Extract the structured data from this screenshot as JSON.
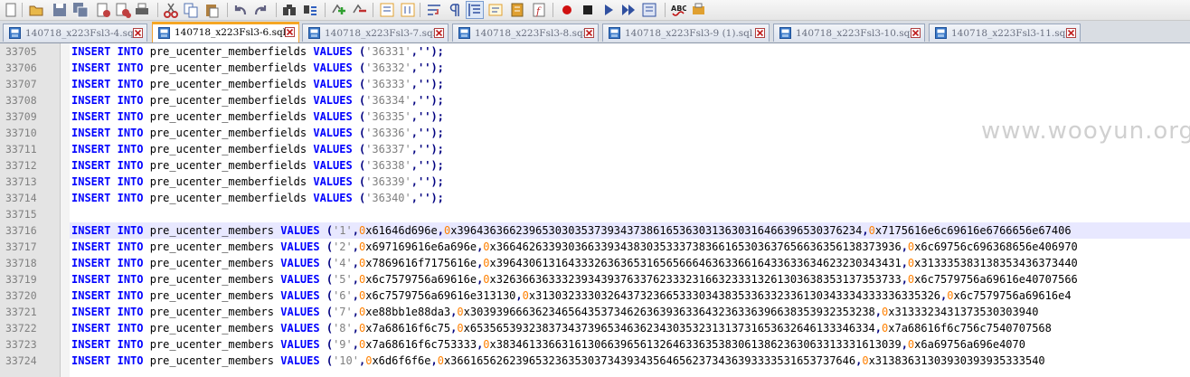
{
  "toolbar": {
    "buttons": [
      {
        "name": "new-file-icon",
        "color": "#ffffff"
      },
      {
        "name": "open-file-icon",
        "color": "#e8b84a"
      },
      {
        "name": "save-icon",
        "color": "#7080a0"
      },
      {
        "name": "save-all-icon",
        "color": "#7080a0"
      },
      {
        "name": "close-icon",
        "color": "#c04040"
      },
      {
        "name": "close-all-icon",
        "color": "#c04040"
      },
      {
        "name": "print-icon",
        "color": "#606060"
      },
      {
        "name": "cut-icon",
        "color": "#c03030"
      },
      {
        "name": "copy-icon",
        "color": "#5070b0"
      },
      {
        "name": "paste-icon",
        "color": "#b08040"
      },
      {
        "name": "undo-icon",
        "color": "#606080"
      },
      {
        "name": "redo-icon",
        "color": "#606080"
      },
      {
        "name": "find-icon",
        "color": "#404040"
      },
      {
        "name": "replace-icon",
        "color": "#3060c0"
      },
      {
        "name": "zoom-in-icon",
        "color": "#30a030"
      },
      {
        "name": "zoom-out-icon",
        "color": "#c03030"
      },
      {
        "name": "sync-vertical-icon",
        "color": "#e0a030"
      },
      {
        "name": "sync-horizontal-icon",
        "color": "#e0a030"
      },
      {
        "name": "word-wrap-icon",
        "color": "#3050a0"
      },
      {
        "name": "show-all-characters-icon",
        "color": "#3050a0"
      },
      {
        "name": "indent-guide-icon",
        "color": "#3050a0"
      },
      {
        "name": "user-language-icon",
        "color": "#e0a030"
      },
      {
        "name": "document-map-icon",
        "color": "#e0a030"
      },
      {
        "name": "function-list-icon",
        "color": "#c03030"
      },
      {
        "name": "record-macro-icon",
        "color": "#d01010"
      },
      {
        "name": "stop-recording-icon",
        "color": "#202020"
      },
      {
        "name": "play-macro-icon",
        "color": "#3050a0"
      },
      {
        "name": "run-macro-multiple-icon",
        "color": "#3050a0"
      },
      {
        "name": "save-macro-icon",
        "color": "#3050a0"
      },
      {
        "name": "spell-check-icon",
        "color": "#c01010"
      },
      {
        "name": "spell-settings-icon",
        "color": "#e0a030"
      }
    ]
  },
  "tabs": [
    {
      "label": "140718_x223Fsl3-4.sql",
      "active": false
    },
    {
      "label": "140718_x223Fsl3-6.sql",
      "active": true
    },
    {
      "label": "140718_x223Fsl3-7.sql",
      "active": false
    },
    {
      "label": "140718_x223Fsl3-8.sql",
      "active": false
    },
    {
      "label": "140718_x223Fsl3-9 (1).sql",
      "active": false
    },
    {
      "label": "140718_x223Fsl3-10.sql",
      "active": false
    },
    {
      "label": "140718_x223Fsl3-11.sql",
      "active": false
    }
  ],
  "editor": {
    "keywords": {
      "insert": "INSERT",
      "into": "INTO",
      "values": "VALUES"
    },
    "lines": [
      {
        "num": "33705",
        "table": "pre_ucenter_memberfields",
        "v1": "'36331'",
        "rest": ",'');"
      },
      {
        "num": "33706",
        "table": "pre_ucenter_memberfields",
        "v1": "'36332'",
        "rest": ",'');"
      },
      {
        "num": "33707",
        "table": "pre_ucenter_memberfields",
        "v1": "'36333'",
        "rest": ",'');"
      },
      {
        "num": "33708",
        "table": "pre_ucenter_memberfields",
        "v1": "'36334'",
        "rest": ",'');"
      },
      {
        "num": "33709",
        "table": "pre_ucenter_memberfields",
        "v1": "'36335'",
        "rest": ",'');"
      },
      {
        "num": "33710",
        "table": "pre_ucenter_memberfields",
        "v1": "'36336'",
        "rest": ",'');"
      },
      {
        "num": "33711",
        "table": "pre_ucenter_memberfields",
        "v1": "'36337'",
        "rest": ",'');"
      },
      {
        "num": "33712",
        "table": "pre_ucenter_memberfields",
        "v1": "'36338'",
        "rest": ",'');"
      },
      {
        "num": "33713",
        "table": "pre_ucenter_memberfields",
        "v1": "'36339'",
        "rest": ",'');"
      },
      {
        "num": "33714",
        "table": "pre_ucenter_memberfields",
        "v1": "'36340'",
        "rest": ",'');"
      },
      {
        "num": "33715",
        "blank": true
      },
      {
        "num": "33716",
        "table": "pre_ucenter_members",
        "v1": "'1'",
        "h1": "x61646d696e",
        "h2": "x39643636623965303035373934373861653630313630316466396530376234",
        "h3": "x7175616e6c69616e6766656e67406",
        "current": true
      },
      {
        "num": "33717",
        "table": "pre_ucenter_members",
        "v1": "'2'",
        "h1": "x697169616e6a696e",
        "h2": "x36646263393036633934383035333738366165303637656636356138373936",
        "h3": "x6c69756c696368656e406970"
      },
      {
        "num": "33718",
        "table": "pre_ucenter_members",
        "v1": "'4'",
        "h1": "x7869616f7175616e",
        "h2": "x39643061316433326363653165656664636336616433633634623230343431",
        "h3": "x313335383138353436373440"
      },
      {
        "num": "33719",
        "table": "pre_ucenter_members",
        "v1": "'5'",
        "h1": "x6c7579756a69616e",
        "h2": "x32636636333239343937633762333231663233313261303638353137353733",
        "h3": "x6c7579756a69616e40707566"
      },
      {
        "num": "33720",
        "table": "pre_ucenter_members",
        "v1": "'6'",
        "h1": "x6c7579756a69616e313130",
        "h2": "x31303233303264373236653330343835336332336130343334333336335326",
        "h3": "x6c7579756a69616e4"
      },
      {
        "num": "33721",
        "table": "pre_ucenter_members",
        "v1": "'7'",
        "h1": "xe88bb1e88da3",
        "h2": "x30393966636234656435373462636393633643236336396638353932353238",
        "h3": "x3133323431373530303940"
      },
      {
        "num": "33722",
        "table": "pre_ucenter_members",
        "v1": "'8'",
        "h1": "x7a68616f6c75",
        "h2": "x65356539323837343739653463623430353231313731653632646133346334",
        "h3": "x7a68616f6c756c7540707568"
      },
      {
        "num": "33723",
        "table": "pre_ucenter_members",
        "v1": "'9'",
        "h1": "x7a68616f6c753333",
        "h2": "x38346133663161306639656132646336353830613862363063313331613039",
        "h3": "x6a69756a696e4070"
      },
      {
        "num": "33724",
        "table": "pre_ucenter_members",
        "v1": "'10'",
        "h1": "x6d6f6f6e",
        "h2": "x36616562623965323635303734393435646562373436393333531653737646",
        "h3": "x31383631303930393935333540"
      }
    ]
  },
  "watermark": {
    "text": "www.wooyun.org"
  }
}
